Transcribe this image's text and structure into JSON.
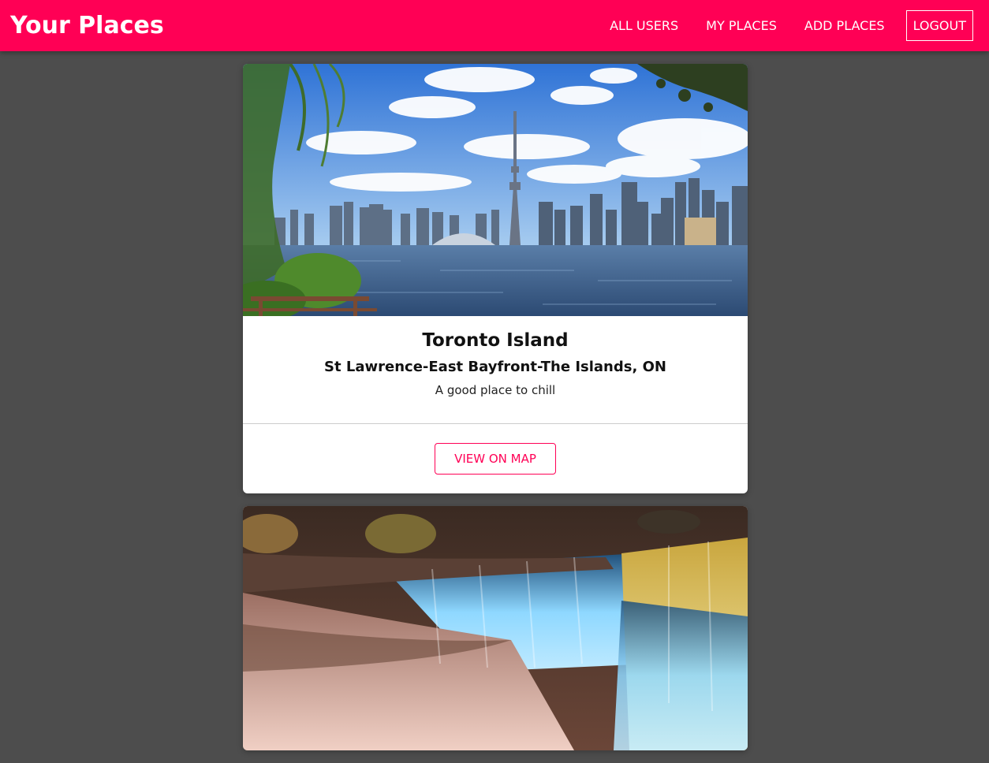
{
  "header": {
    "title": "Your Places",
    "nav": {
      "all_users": "ALL USERS",
      "my_places": "MY PLACES",
      "add_places": "ADD PLACES",
      "logout": "LOGOUT"
    },
    "color": "#ff0055"
  },
  "places": [
    {
      "title": "Toronto Island",
      "address": "St Lawrence-East Bayfront-The Islands, ON",
      "description": "A good place to chill",
      "action_label": "VIEW ON MAP"
    }
  ]
}
